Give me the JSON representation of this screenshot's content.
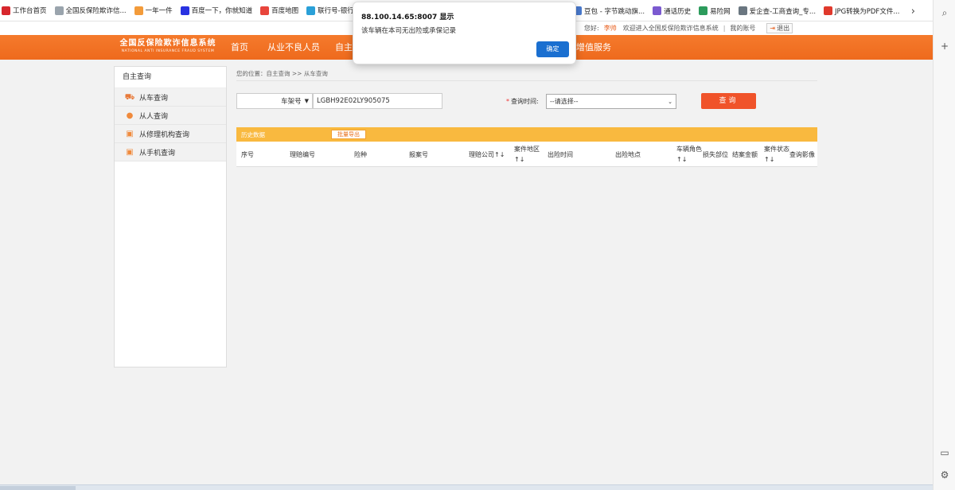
{
  "bookmarks": [
    {
      "label": "工作台首页",
      "icon": "ejc-logo-icon",
      "color": "#d7272d"
    },
    {
      "label": "全国反保险欺诈信...",
      "icon": "page-icon",
      "color": "#9aa4ad"
    },
    {
      "label": "一年一件",
      "icon": "orange-logo-icon",
      "color": "#f39b3a"
    },
    {
      "label": "百度一下，你就知道",
      "icon": "baidu-paw-icon",
      "color": "#2932e1"
    },
    {
      "label": "百度地图",
      "icon": "map-pin-icon",
      "color": "#e8453c"
    },
    {
      "label": "联行号-银行联行号...",
      "icon": "globe-icon",
      "color": "#2aa0d8"
    }
  ],
  "bookmarks_right": [
    {
      "label": "豆包 - 字节跳动旗...",
      "icon": "doubao-icon",
      "color": "#4a7bd0"
    },
    {
      "label": "通话历史",
      "icon": "call-history-icon",
      "color": "#7b5ad0"
    },
    {
      "label": "易险网",
      "icon": "yixian-icon",
      "color": "#2c9b5c"
    },
    {
      "label": "爱企查-工商查询_专...",
      "icon": "aiqicha-icon",
      "color": "#6a7680"
    },
    {
      "label": "JPG转换为PDF文件...",
      "icon": "heart-icon",
      "color": "#e0392c"
    }
  ],
  "more_icon": "chevron-right-icon",
  "info": {
    "greeting": "您好:",
    "user": "李帅",
    "welcome": "欢迎进入全国反保险欺诈信息系统",
    "separator": "|",
    "account": "我的账号",
    "logout": "退出"
  },
  "logo": {
    "cn": "全国反保险欺诈信息系统",
    "en": "NATIONAL ANTI INSURANCE FRAUD SYSTEM"
  },
  "nav": [
    "首页",
    "从业不良人员",
    "自主",
    "增值服务"
  ],
  "left_panel": {
    "title": "自主查询",
    "items": [
      {
        "label": "从车查询",
        "icon": "car-icon"
      },
      {
        "label": "从人查询",
        "icon": "person-icon"
      },
      {
        "label": "从修理机构查询",
        "icon": "repair-shop-icon"
      },
      {
        "label": "从手机查询",
        "icon": "phone-icon"
      }
    ]
  },
  "breadcrumb": "您的位置：自主查询 >> 从车查询",
  "search": {
    "type_selected": "车架号",
    "vin_value": "LGBH92E02LY905075",
    "time_label": "查询时间:",
    "time_required": "*",
    "time_selected": "--请选择--",
    "query_button": "查询"
  },
  "history": {
    "title": "历史数据",
    "export_button": "批量导出"
  },
  "table": {
    "headers": [
      "序号",
      "理赔编号",
      "险种",
      "报案号",
      "理赔公司↑↓",
      "案件地区↑↓",
      "出险时间",
      "出险地点",
      "车辆角色↑↓",
      "损失部位",
      "结案金额",
      "案件状态↑↓",
      "查询影像"
    ]
  },
  "dialog": {
    "title": "88.100.14.65:8007 显示",
    "message": "该车辆在本司无出险或承保记录",
    "ok_button": "确定"
  }
}
